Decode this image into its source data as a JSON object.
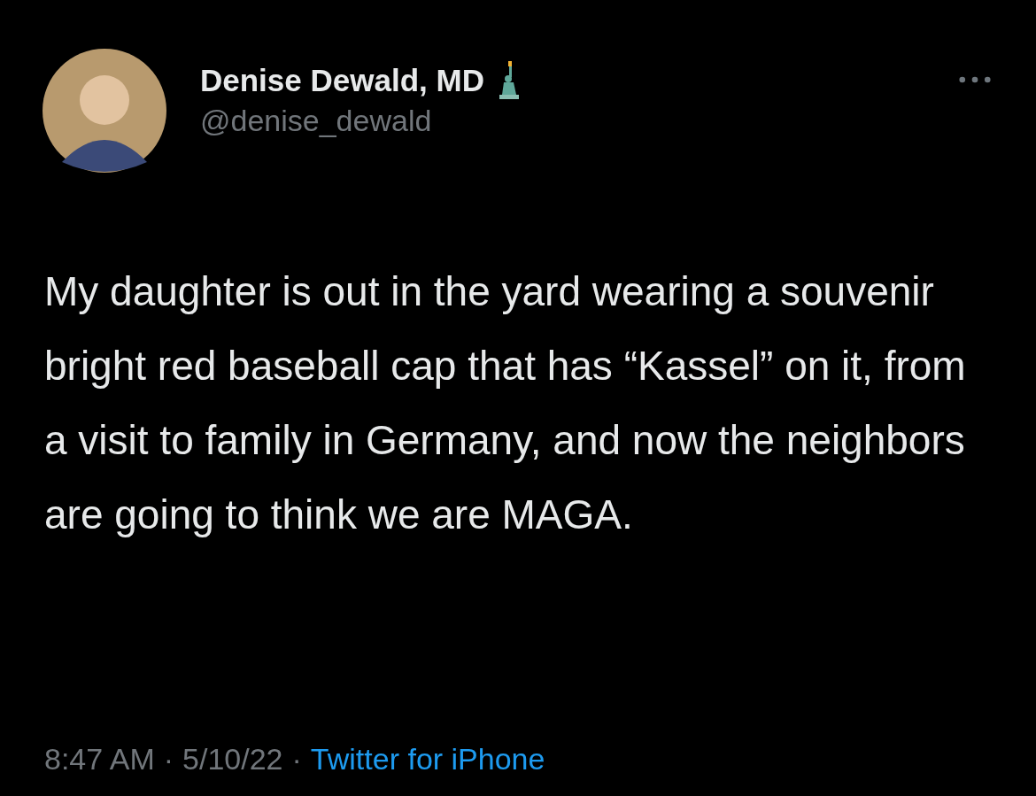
{
  "author": {
    "name": "Denise Dewald, MD",
    "handle": "@denise_dewald"
  },
  "tweet": {
    "text": "My daughter is out in the yard wearing a souvenir bright red baseball cap that has “Kassel” on it, from a visit to family in Germany, and now the neighbors are going to think we are MAGA."
  },
  "meta": {
    "time": "8:47 AM",
    "separators": [
      "·",
      "·"
    ],
    "date": "5/10/22",
    "source": "Twitter for iPhone"
  }
}
